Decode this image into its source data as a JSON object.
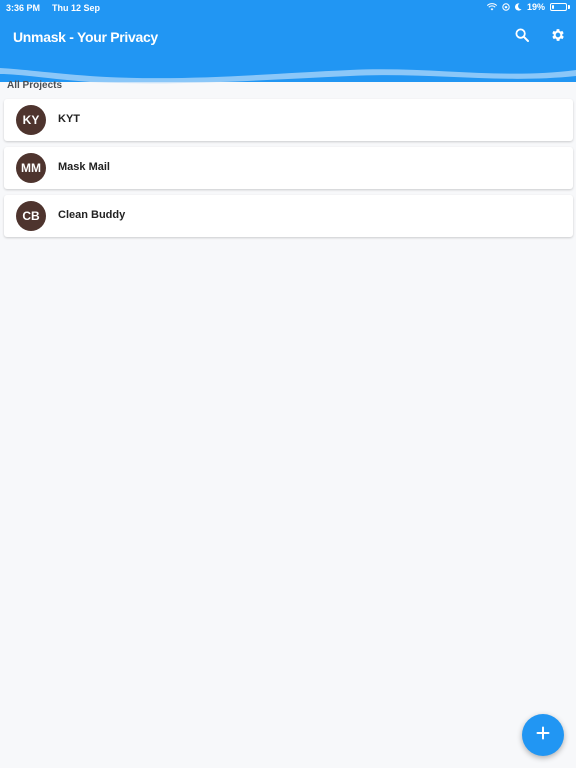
{
  "status_bar": {
    "time": "3:36 PM",
    "date": "Thu 12 Sep",
    "battery_percent": "19%",
    "battery_level": 0.19
  },
  "header": {
    "title": "Unmask - Your Privacy",
    "search_icon": "search-icon",
    "settings_icon": "gear-icon"
  },
  "section": {
    "title": "All Projects"
  },
  "projects": [
    {
      "initials": "KY",
      "name": "KYT"
    },
    {
      "initials": "MM",
      "name": "Mask Mail"
    },
    {
      "initials": "CB",
      "name": "Clean Buddy"
    }
  ],
  "fab": {
    "label": "+",
    "icon": "plus-icon"
  },
  "colors": {
    "primary": "#2196f3",
    "avatar": "#4e342e",
    "background": "#f7f8fa"
  }
}
